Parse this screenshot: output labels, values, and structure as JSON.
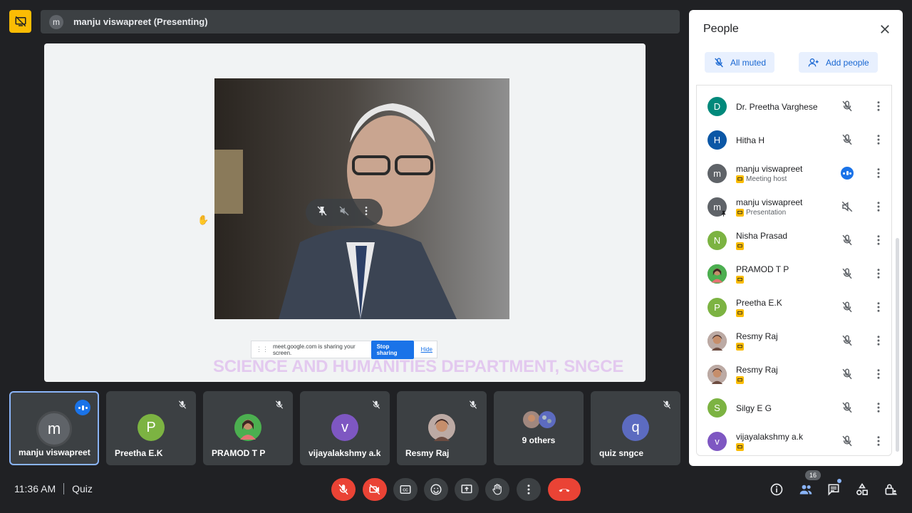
{
  "presenter_bar": {
    "avatar_initial": "m",
    "text": "manju viswapreet (Presenting)"
  },
  "stage": {
    "share_bar": {
      "message": "meet.google.com is sharing your screen.",
      "stop_label": "Stop sharing",
      "hide_label": "Hide"
    },
    "watermark": "SCIENCE AND HUMANITIES DEPARTMENT, SNGCE"
  },
  "tiles": [
    {
      "name": "manju viswapreet",
      "initial": "m",
      "color": "#5f6368",
      "active": true
    },
    {
      "name": "Preetha E.K",
      "initial": "P",
      "color": "#7cb342"
    },
    {
      "name": "PRAMOD T P",
      "initial": "",
      "color": "#2e7d32"
    },
    {
      "name": "vijayalakshmy a.k",
      "initial": "v",
      "color": "#7e57c2"
    },
    {
      "name": "Resmy Raj",
      "initial": "",
      "color": "#8d6e63"
    },
    {
      "others_label": "9 others"
    },
    {
      "name": "quiz sngce",
      "initial": "q",
      "color": "#5c6bc0"
    }
  ],
  "bottom": {
    "time": "11:36 AM",
    "meeting_name": "Quiz",
    "people_count": "16"
  },
  "panel": {
    "title": "People",
    "all_muted_label": "All muted",
    "add_people_label": "Add people",
    "participants": [
      {
        "name": "Dr. Preetha Varghese",
        "initial": "D",
        "color": "#00897b",
        "sub": ""
      },
      {
        "name": "Hitha H",
        "initial": "H",
        "color": "#0b57a6",
        "sub": ""
      },
      {
        "name": "manju viswapreet",
        "initial": "m",
        "color": "#5f6368",
        "sub": "Meeting host"
      },
      {
        "name": "manju viswapreet",
        "initial": "m",
        "color": "#5f6368",
        "sub": "Presentation"
      },
      {
        "name": "Nisha Prasad",
        "initial": "N",
        "color": "#7cb342",
        "sub": ""
      },
      {
        "name": "PRAMOD T P",
        "initial": "",
        "color": "#2e7d32",
        "sub": ""
      },
      {
        "name": "Preetha E.K",
        "initial": "P",
        "color": "#7cb342",
        "sub": ""
      },
      {
        "name": "Resmy Raj",
        "initial": "",
        "color": "#8d6e63",
        "sub": ""
      },
      {
        "name": "Resmy Raj",
        "initial": "",
        "color": "#8d6e63",
        "sub": ""
      },
      {
        "name": "Silgy E G",
        "initial": "S",
        "color": "#7cb342",
        "sub": ""
      },
      {
        "name": "vijayalakshmy a.k",
        "initial": "v",
        "color": "#7e57c2",
        "sub": ""
      }
    ]
  }
}
